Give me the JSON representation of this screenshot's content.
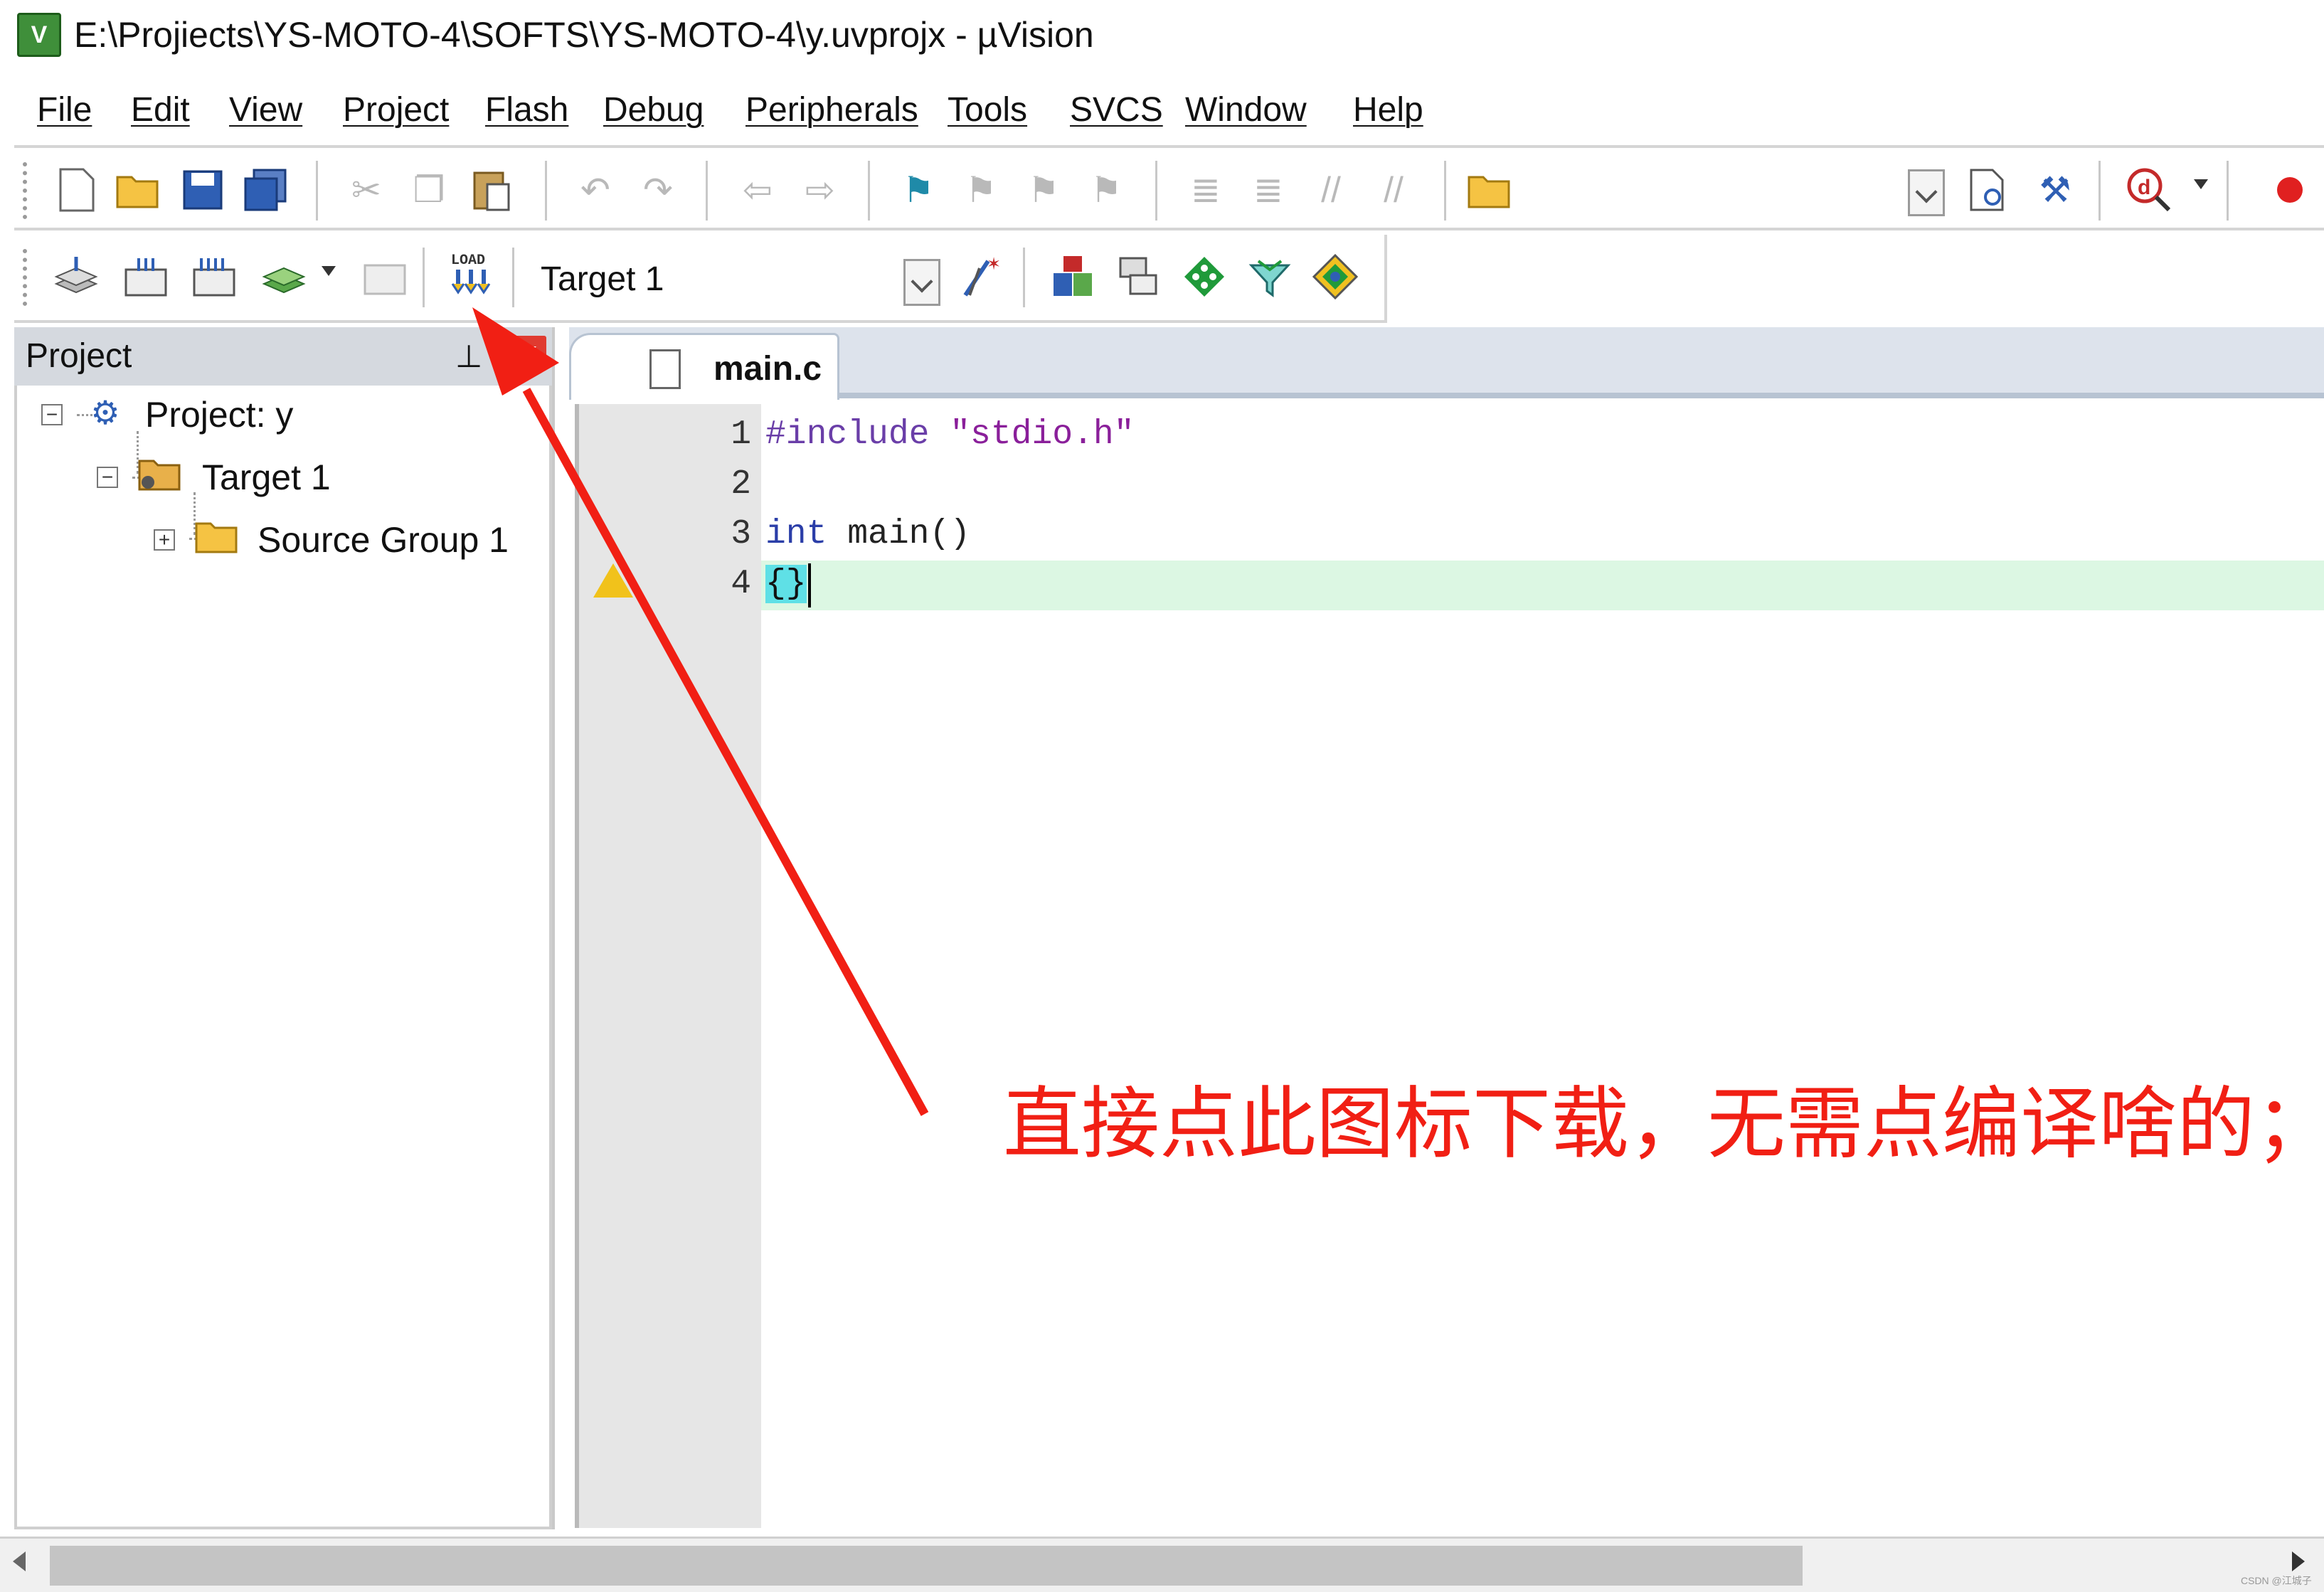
{
  "window": {
    "title": "E:\\Projiects\\YS-MOTO-4\\SOFTS\\YS-MOTO-4\\y.uvprojx - µVision",
    "icon_text": "V"
  },
  "menu": [
    "File",
    "Edit",
    "View",
    "Project",
    "Flash",
    "Debug",
    "Peripherals",
    "Tools",
    "SVCS",
    "Window",
    "Help"
  ],
  "toolbar1": {
    "icons": [
      "new-file-icon",
      "open-file-icon",
      "save-icon",
      "save-all-icon",
      "cut-icon",
      "copy-icon",
      "paste-icon",
      "undo-icon",
      "redo-icon",
      "nav-back-icon",
      "nav-forward-icon",
      "bookmark-icon",
      "prev-bookmark-icon",
      "next-bookmark-icon",
      "clear-bookmarks-icon",
      "indent-icon",
      "unindent-icon",
      "comment-icon",
      "uncomment-icon",
      "find-in-files-icon",
      "find-icon",
      "debug-session-icon",
      "breakpoint-icon"
    ]
  },
  "toolbar2": {
    "target": "Target 1",
    "load_icon_text": "LOAD",
    "icons": [
      "translate-icon",
      "build-icon",
      "rebuild-icon",
      "batch-build-icon",
      "stop-build-icon",
      "download-load-icon",
      "target-options-icon",
      "manage-components-icon",
      "file-extensions-icon",
      "pack-installer-icon",
      "select-packs-icon",
      "runtime-environment-icon"
    ]
  },
  "project_panel": {
    "title": "Project",
    "pin": "⊥",
    "close": "x",
    "tree": [
      {
        "label": "Project: y",
        "expander": "−"
      },
      {
        "label": "Target 1",
        "expander": "−"
      },
      {
        "label": "Source Group 1",
        "expander": "+"
      }
    ]
  },
  "editor": {
    "tab": "main.c",
    "lines": [
      {
        "no": "1",
        "text": "#include \"stdio.h\""
      },
      {
        "no": "2",
        "text": ""
      },
      {
        "no": "3",
        "text": "int main()"
      },
      {
        "no": "4",
        "text": "{}"
      }
    ]
  },
  "annotation": {
    "text": "直接点此图标下载，无需点编译啥的；",
    "color": "#f11f14"
  },
  "watermark": "CSDN @江城子"
}
